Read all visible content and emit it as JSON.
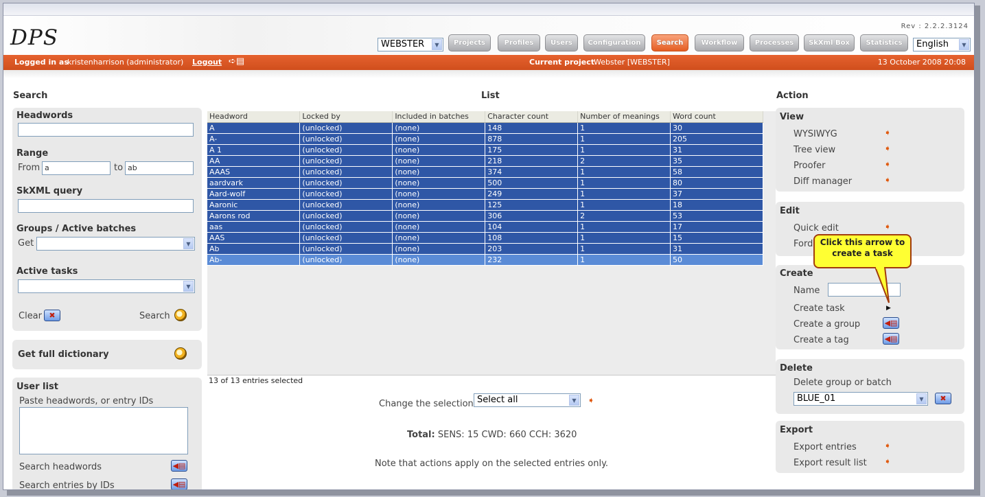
{
  "app": {
    "logo": "DPS",
    "revision": "Rev : 2.2.2.3124"
  },
  "header": {
    "project_select": "WEBSTER",
    "nav": [
      "Projects",
      "Profiles",
      "Users",
      "Configuration",
      "Search",
      "Workflow",
      "Processes",
      "SkXml Box",
      "Statistics"
    ],
    "active_nav": "Search",
    "language": "English"
  },
  "userbar": {
    "logged_label": "Logged in as",
    "user": "kristenharrison (administrator)",
    "logout": "Logout",
    "project_label": "Current project",
    "project": "Webster [WEBSTER]",
    "datetime": "13 October 2008 20:08"
  },
  "search": {
    "title": "Search",
    "headwords_label": "Headwords",
    "headwords_value": "",
    "range_label": "Range",
    "from_label": "From",
    "from_value": "a",
    "to_label": "to",
    "to_value": "ab",
    "skxml_label": "SkXML query",
    "groups_label": "Groups / Active batches",
    "get_label": "Get",
    "tasks_label": "Active tasks",
    "clear_label": "Clear",
    "search_label": "Search",
    "full_dict_label": "Get full dictionary",
    "userlist_label": "User list",
    "paste_label": "Paste headwords, or entry IDs",
    "search_headwords": "Search headwords",
    "search_ids": "Search entries by IDs"
  },
  "list": {
    "title": "List",
    "columns": [
      "Headword",
      "Locked by",
      "Included in batches",
      "Character count",
      "Number of meanings",
      "Word count"
    ],
    "rows": [
      [
        "A",
        "(unlocked)",
        "(none)",
        "148",
        "1",
        "30"
      ],
      [
        "A-",
        "(unlocked)",
        "(none)",
        "878",
        "1",
        "205"
      ],
      [
        "A 1",
        "(unlocked)",
        "(none)",
        "175",
        "1",
        "31"
      ],
      [
        "AA",
        "(unlocked)",
        "(none)",
        "218",
        "2",
        "35"
      ],
      [
        "AAAS",
        "(unlocked)",
        "(none)",
        "374",
        "1",
        "58"
      ],
      [
        "aardvark",
        "(unlocked)",
        "(none)",
        "500",
        "1",
        "80"
      ],
      [
        "Aard-wolf",
        "(unlocked)",
        "(none)",
        "249",
        "1",
        "37"
      ],
      [
        "Aaronic",
        "(unlocked)",
        "(none)",
        "125",
        "1",
        "18"
      ],
      [
        "Aarons rod",
        "(unlocked)",
        "(none)",
        "306",
        "2",
        "53"
      ],
      [
        "aas",
        "(unlocked)",
        "(none)",
        "104",
        "1",
        "17"
      ],
      [
        "AAS",
        "(unlocked)",
        "(none)",
        "108",
        "1",
        "15"
      ],
      [
        "Ab",
        "(unlocked)",
        "(none)",
        "203",
        "1",
        "31"
      ],
      [
        "Ab-",
        "(unlocked)",
        "(none)",
        "232",
        "1",
        "50"
      ]
    ],
    "status": "13 of 13 entries selected",
    "change_label": "Change the selection",
    "change_value": "Select all",
    "total_label": "Total:",
    "total_value": "SENS: 15 CWD: 660 CCH: 3620",
    "note": "Note that actions apply on the selected entries only."
  },
  "action": {
    "title": "Action",
    "view_title": "View",
    "view_items": [
      "WYSIWYG",
      "Tree view",
      "Proofer",
      "Diff manager"
    ],
    "edit_title": "Edit",
    "edit_items": [
      "Quick edit",
      "Ford"
    ],
    "create_title": "Create",
    "name_label": "Name",
    "create_task": "Create task",
    "create_group": "Create a group",
    "create_tag": "Create a tag",
    "delete_title": "Delete",
    "delete_label": "Delete group or batch",
    "delete_value": "BLUE_01",
    "export_title": "Export",
    "export_items": [
      "Export entries",
      "Export result list"
    ]
  },
  "callout": "Click this arrow to create a task"
}
